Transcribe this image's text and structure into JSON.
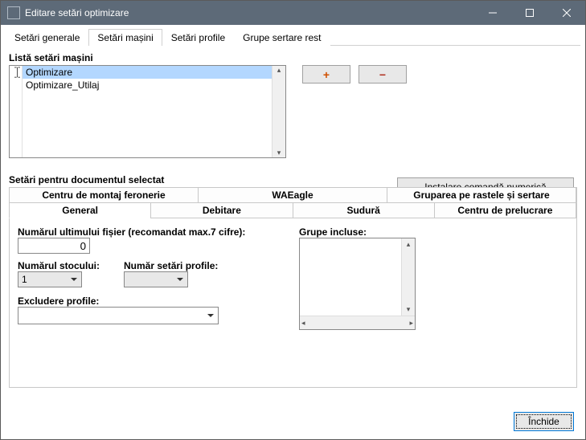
{
  "window": {
    "title": "Editare setări optimizare"
  },
  "main_tabs": {
    "t0": "Setări generale",
    "t1": "Setări mașini",
    "t2": "Setări profile",
    "t3": "Grupe sertare rest"
  },
  "list_section": {
    "label": "Listă setări mașini",
    "items": [
      "Optimizare",
      "Optimizare_Utilaj"
    ]
  },
  "buttons": {
    "install": "Instalare comandă numerică",
    "close": "Închide"
  },
  "doc_section": {
    "label": "Setări pentru documentul selectat"
  },
  "sub_tabs_row1": {
    "t0": "Centru de montaj feronerie",
    "t1": "WAEagle",
    "t2": "Gruparea pe rastele și sertare"
  },
  "sub_tabs_row2": {
    "t0": "General",
    "t1": "Debitare",
    "t2": "Sudură",
    "t3": "Centru de prelucrare"
  },
  "form": {
    "last_file_label": "Numărul ultimului fișier (recomandat max.7 cifre):",
    "last_file_value": "0",
    "stock_label": "Numărul stocului:",
    "stock_value": "1",
    "profile_setting_label": "Număr setări profile:",
    "profile_setting_value": "",
    "exclude_label": "Excludere profile:",
    "exclude_value": "",
    "groups_label": "Grupe incluse:"
  }
}
